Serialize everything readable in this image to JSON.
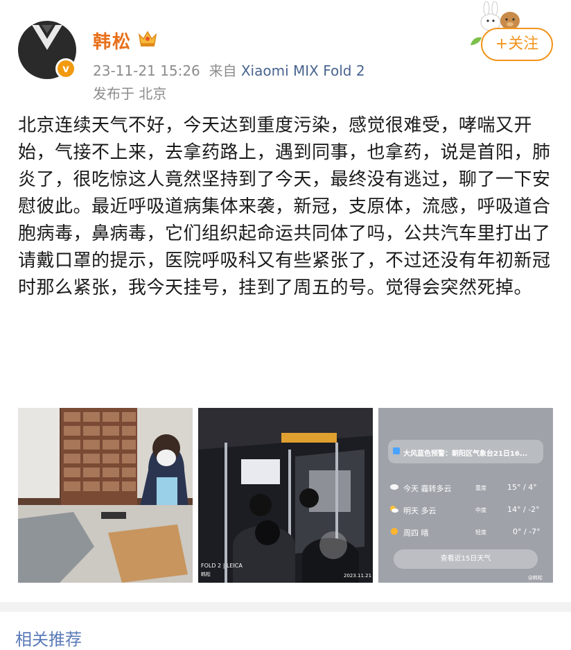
{
  "post": {
    "author": "韩松",
    "date": "23-11-21 15:26",
    "source_prefix": "来自",
    "source_device": "Xiaomi MIX Fold 2",
    "location": "发布于 北京",
    "follow_label": "+关注",
    "verified_badge": "v",
    "text": "北京连续天气不好，今天达到重度污染，感觉很难受，哮喘又开始，气接不上来，去拿药路上，遇到同事，也拿药，说是首阳，肺炎了，很吃惊这人竟然坚持到了今天，最终没有逃过，聊了一下安慰彼此。最近呼吸道病集体来袭，新冠，支原体，流感，呼吸道合胞病毒，鼻病毒，它们组织起命运共同体了吗，公共汽车里打出了请戴口罩的提示，医院呼吸科又有些紧张了，不过还没有年初新冠时那么紧张，我今天挂号，挂到了周五的号。觉得会突然死掉。"
  },
  "images": {
    "bus_watermark_left": "FOLD 2 | LEICA",
    "bus_watermark_sub": "韩松",
    "bus_watermark_date": "2023.11.21",
    "weather": {
      "alert": "大风蓝色预警：朝阳区气象台21日16...",
      "rows": [
        {
          "day": "今天  霾转多云",
          "aqi": "重度",
          "temp": "15° / 4°"
        },
        {
          "day": "明天  多云",
          "aqi": "中度",
          "temp": "14° / -2°"
        },
        {
          "day": "周四  晴",
          "aqi": "轻度",
          "temp": "0° / -7°"
        }
      ],
      "button": "查看近15日天气",
      "watermark": "@韩松"
    }
  },
  "related_title": "相关推荐"
}
